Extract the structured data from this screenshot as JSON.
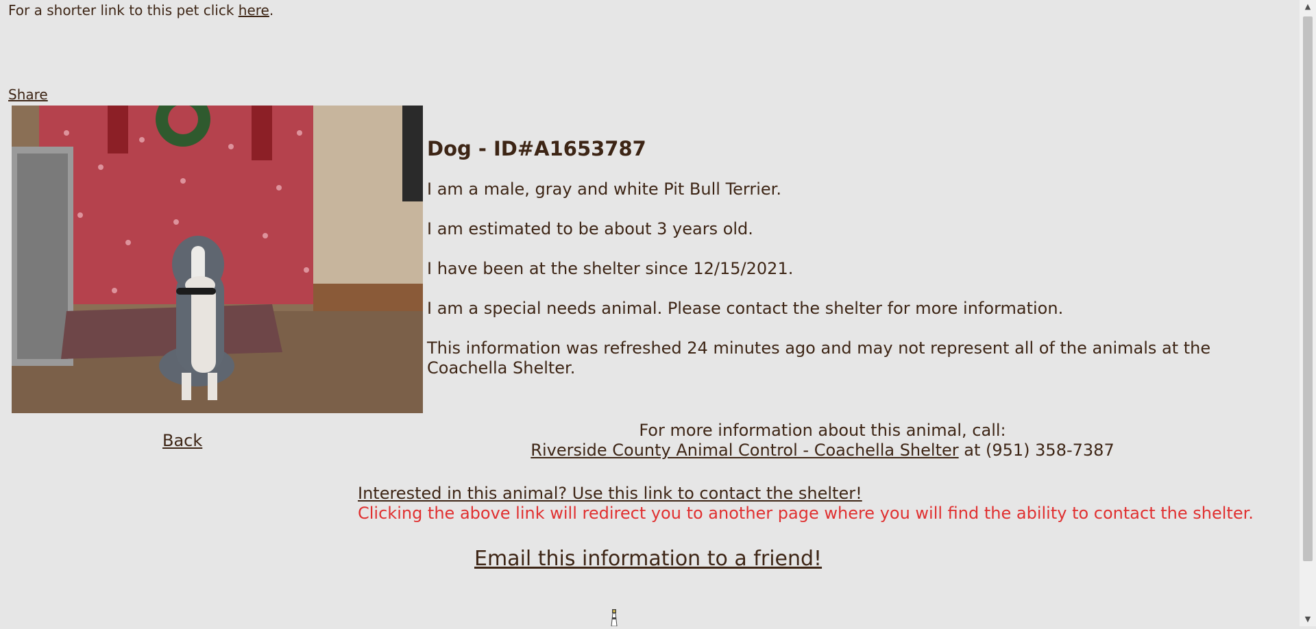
{
  "top": {
    "prefix": "For a shorter link to this pet click ",
    "link": "here",
    "suffix": "."
  },
  "share_label": "Share",
  "back_label": "Back",
  "animal": {
    "heading": "Dog - ID#A1653787",
    "description": "I am a male, gray and white Pit Bull Terrier.",
    "age": "I am estimated to be about 3 years old.",
    "since": "I have been at the shelter since 12/15/2021.",
    "special_needs": "I am a special needs animal. Please contact the shelter for more information.",
    "refresh_note": "This information was refreshed 24 minutes ago and may not represent all of the animals at the Coachella Shelter."
  },
  "contact": {
    "intro": "For more information about this animal, call:",
    "shelter_link": "Riverside County Animal Control - Coachella Shelter",
    "phone_text": " at (951) 358-7387"
  },
  "interest": {
    "link": "Interested in this animal? Use this link to contact the shelter!",
    "warning": "Clicking the above link will redirect you to another page where you will find the ability to contact the shelter."
  },
  "email_label": "Email this information to a friend!",
  "colors": {
    "background": "#e6e6e6",
    "text": "#3d2515",
    "warning": "#e03030"
  },
  "icons": {
    "scroll_up": "scroll-up-arrow-icon",
    "scroll_down": "scroll-down-arrow-icon",
    "bottom": "lighthouse-icon"
  }
}
